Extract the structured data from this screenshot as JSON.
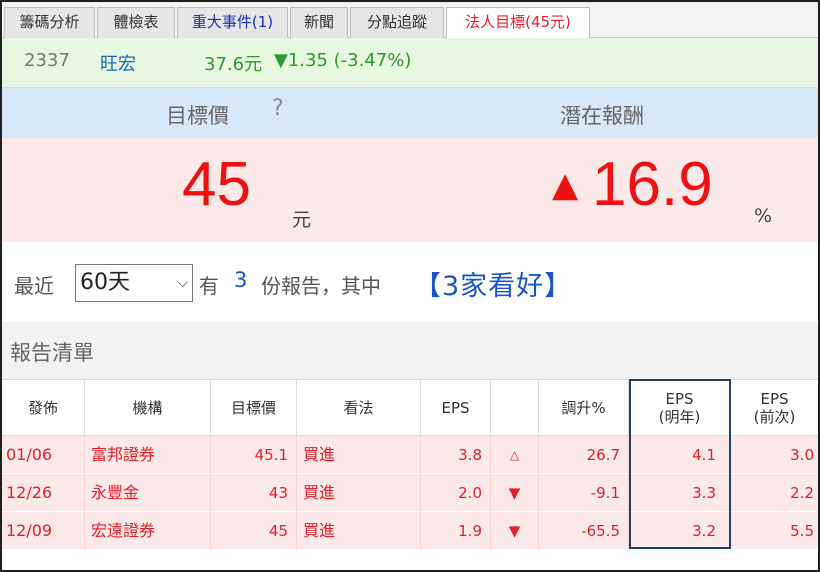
{
  "tabs": [
    {
      "label": "籌碼分析"
    },
    {
      "label": "體檢表"
    },
    {
      "label": "重大事件(1)"
    },
    {
      "label": "新聞"
    },
    {
      "label": "分點追蹤"
    },
    {
      "label": "法人目標(45元)"
    }
  ],
  "stock": {
    "code": "2337",
    "name": "旺宏",
    "price": "37.6元",
    "change": "▼1.35 (-3.47%)"
  },
  "header": {
    "target_label": "目標價",
    "help_icon": "?",
    "potential_label": "潛在報酬"
  },
  "summary": {
    "target_price": "45",
    "target_unit": "元",
    "return_arrow": "▲",
    "return_value": "16.9",
    "return_unit": "%"
  },
  "filter": {
    "prefix": "最近",
    "period": "60天",
    "has": "有",
    "report_count": "3",
    "suffix": "份報告，其中",
    "bullish": "【3家看好】"
  },
  "report_list": {
    "title": "報告清單",
    "columns": [
      "發佈",
      "機構",
      "目標價",
      "看法",
      "EPS",
      "",
      "調升%",
      "EPS\n(明年)",
      "EPS\n(前次)"
    ],
    "rows": [
      {
        "date": "01/06",
        "broker": "富邦證券",
        "target": "45.1",
        "view": "買進",
        "eps": "3.8",
        "dir": "△",
        "adj": "26.7",
        "eps_next": "4.1",
        "eps_prev": "3.0"
      },
      {
        "date": "12/26",
        "broker": "永豐金",
        "target": "43",
        "view": "買進",
        "eps": "2.0",
        "dir": "▼",
        "adj": "-9.1",
        "eps_next": "3.3",
        "eps_prev": "2.2"
      },
      {
        "date": "12/09",
        "broker": "宏遠證券",
        "target": "45",
        "view": "買進",
        "eps": "1.9",
        "dir": "▼",
        "adj": "-65.5",
        "eps_next": "3.2",
        "eps_prev": "5.5"
      }
    ]
  },
  "colors": {
    "up_red": "#ee1111",
    "down_green": "#2e9a2e",
    "tab_blue": "#1a2fb5",
    "highlight_border": "#22405f"
  }
}
